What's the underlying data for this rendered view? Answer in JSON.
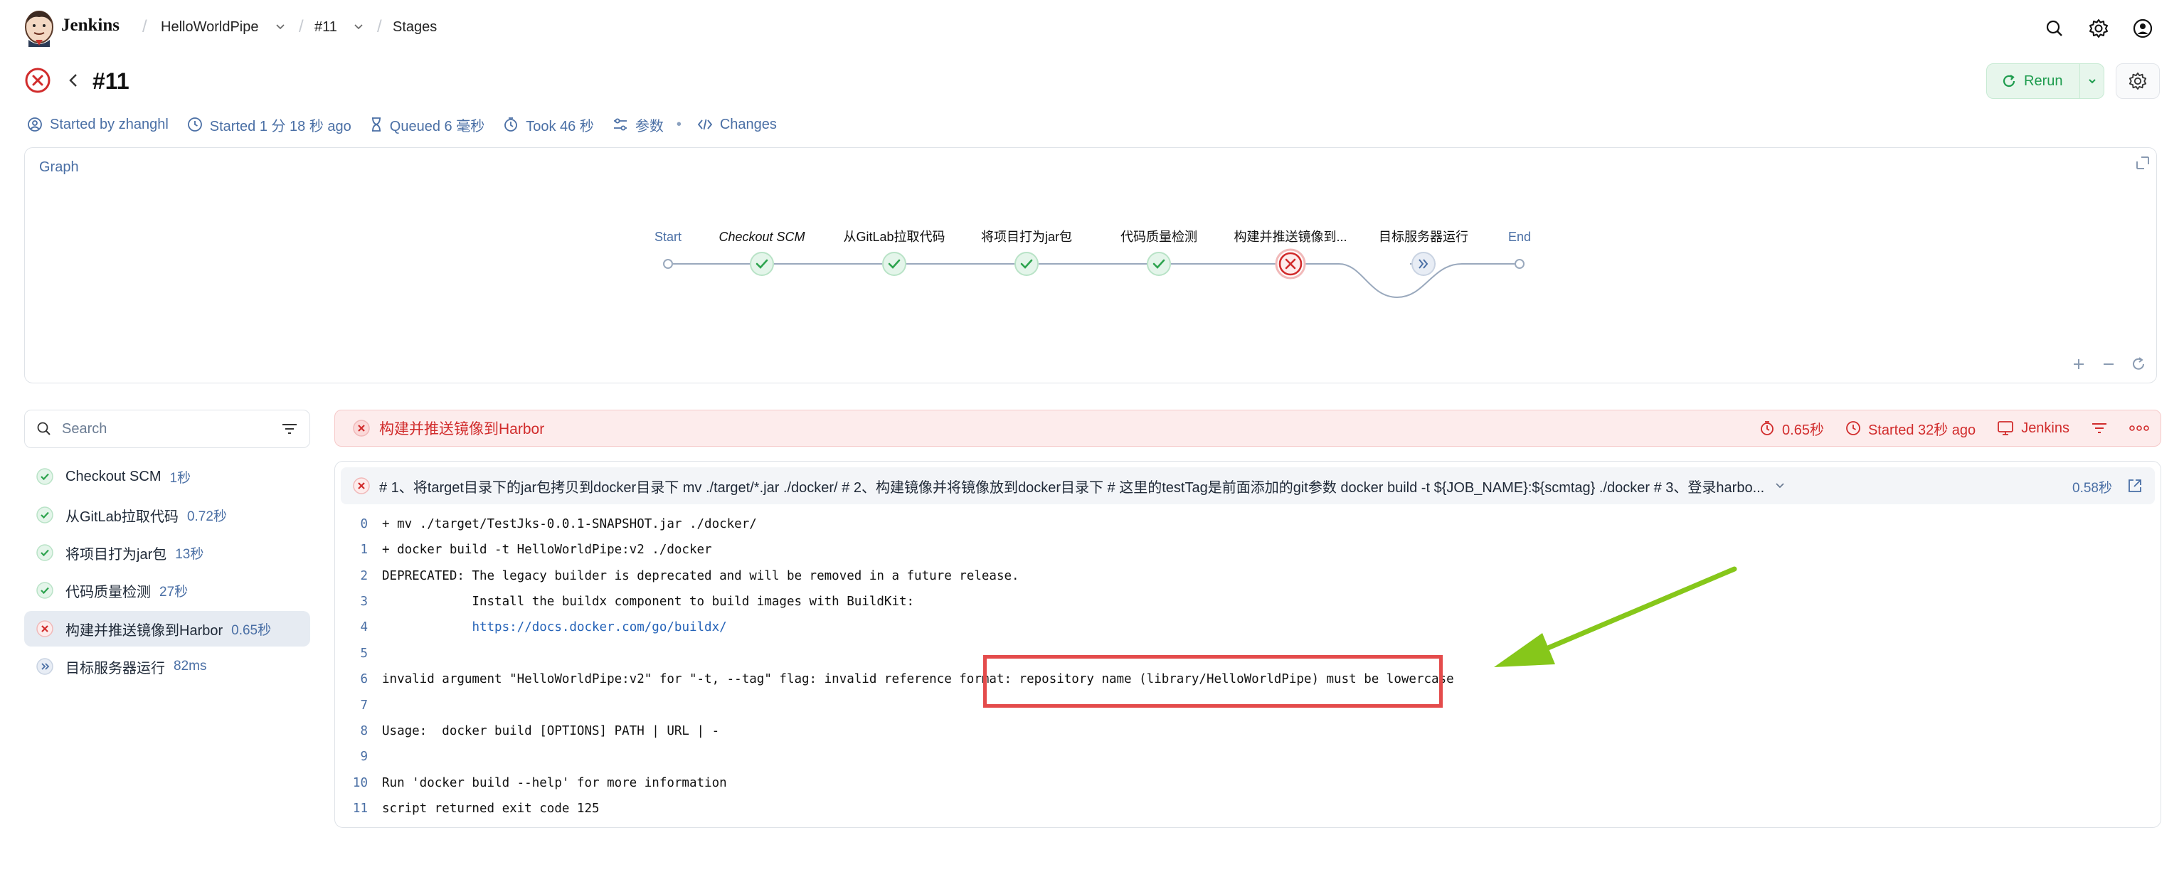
{
  "header": {
    "brand": "Jenkins",
    "breadcrumbs": [
      "HelloWorldPipe",
      "#11",
      "Stages"
    ]
  },
  "run": {
    "title": "#11",
    "rerun_label": "Rerun",
    "status": "failed"
  },
  "meta": {
    "started_by": "Started by zhanghl",
    "started": "Started 1 分 18 秒 ago",
    "queued": "Queued 6 毫秒",
    "took": "Took 46 秒",
    "params": "参数",
    "changes": "Changes"
  },
  "graph": {
    "title": "Graph",
    "start": "Start",
    "end": "End",
    "stages": [
      {
        "label": "Checkout SCM",
        "status": "success"
      },
      {
        "label": "从GitLab拉取代码",
        "status": "success"
      },
      {
        "label": "将项目打为jar包",
        "status": "success"
      },
      {
        "label": "代码质量检测",
        "status": "success"
      },
      {
        "label": "构建并推送镜像到...",
        "status": "failed"
      },
      {
        "label": "目标服务器运行",
        "status": "skipped"
      }
    ]
  },
  "sidebar": {
    "search_placeholder": "Search",
    "items": [
      {
        "label": "Checkout SCM",
        "duration": "1秒",
        "status": "success"
      },
      {
        "label": "从GitLab拉取代码",
        "duration": "0.72秒",
        "status": "success"
      },
      {
        "label": "将项目打为jar包",
        "duration": "13秒",
        "status": "success"
      },
      {
        "label": "代码质量检测",
        "duration": "27秒",
        "status": "success"
      },
      {
        "label": "构建并推送镜像到Harbor",
        "duration": "0.65秒",
        "status": "failed"
      },
      {
        "label": "目标服务器运行",
        "duration": "82ms",
        "status": "skipped"
      }
    ]
  },
  "step": {
    "name": "构建并推送镜像到Harbor",
    "duration": "0.65秒",
    "started": "Started 32秒 ago",
    "agent": "Jenkins",
    "command": "# 1、将target目录下的jar包拷贝到docker目录下 mv ./target/*.jar ./docker/ # 2、构建镜像并将镜像放到docker目录下 # 这里的testTag是前面添加的git参数 docker build -t ${JOB_NAME}:${scmtag} ./docker # 3、登录harbo...",
    "command_duration": "0.58秒"
  },
  "log": [
    {
      "n": "0",
      "text": "+ mv ./target/TestJks-0.0.1-SNAPSHOT.jar ./docker/"
    },
    {
      "n": "1",
      "text": "+ docker build -t HelloWorldPipe:v2 ./docker"
    },
    {
      "n": "2",
      "text": "DEPRECATED: The legacy builder is deprecated and will be removed in a future release."
    },
    {
      "n": "3",
      "text": "            Install the buildx component to build images with BuildKit:"
    },
    {
      "n": "4",
      "text": "            ",
      "link": "https://docs.docker.com/go/buildx/"
    },
    {
      "n": "5",
      "text": ""
    },
    {
      "n": "6",
      "text": "invalid argument \"HelloWorldPipe:v2\" for \"-t, --tag\" flag: invalid reference format: repository name (library/HelloWorldPipe) must be lowercase"
    },
    {
      "n": "7",
      "text": ""
    },
    {
      "n": "8",
      "text": "Usage:  docker build [OPTIONS] PATH | URL | -"
    },
    {
      "n": "9",
      "text": ""
    },
    {
      "n": "10",
      "text": "Run 'docker build --help' for more information"
    },
    {
      "n": "11",
      "text": "script returned exit code 125"
    }
  ],
  "colors": {
    "success": "#2ea44f",
    "failed": "#d12c2c",
    "accent_blue": "#4a6fa5",
    "highlight_box": "#e44b4b",
    "annotation_arrow": "#86c71a"
  }
}
